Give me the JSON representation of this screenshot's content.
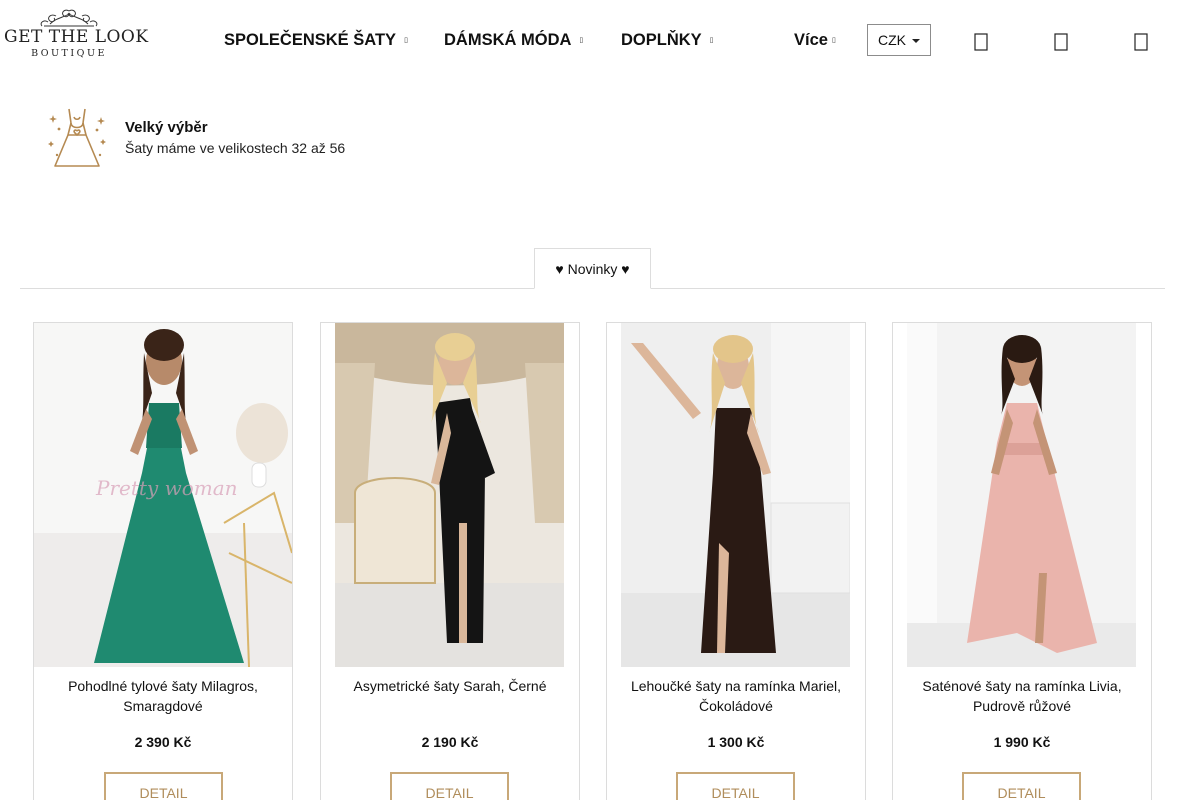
{
  "header": {
    "logo_main": "GET THE LOOK",
    "logo_sub": "BOUTIQUE",
    "nav": [
      {
        "label": "SPOLEČENSKÉ ŠATY",
        "caret": "▯"
      },
      {
        "label": "DÁMSKÁ MÓDA",
        "caret": "▯"
      },
      {
        "label": "DOPLŇKY",
        "caret": "▯"
      },
      {
        "label": "Více",
        "caret": "▯"
      }
    ],
    "currency": "CZK",
    "icons": [
      "search-icon",
      "user-icon",
      "cart-icon"
    ]
  },
  "benefit": {
    "icon": "dress-icon",
    "title": "Velký výběr",
    "text": "Šaty máme ve velikostech 32 až 56"
  },
  "tabs": {
    "active_label": "♥ Novinky ♥"
  },
  "products": [
    {
      "name": "Pohodlné tylové šaty Milagros, Smaragdové",
      "price": "2 390 Kč",
      "button": "DETAIL",
      "dress_color": "#1f8a70",
      "watermark": "Pretty woman"
    },
    {
      "name": "Asymetrické šaty Sarah, Černé",
      "price": "2 190 Kč",
      "button": "DETAIL",
      "dress_color": "#141414"
    },
    {
      "name": "Lehoučké šaty na ramínka Mariel, Čokoládové",
      "price": "1 300 Kč",
      "button": "DETAIL",
      "dress_color": "#2a1a14"
    },
    {
      "name": "Saténové šaty na ramínka Livia, Pudrově růžové",
      "price": "1 990 Kč",
      "button": "DETAIL",
      "dress_color": "#eab4ac"
    }
  ],
  "colors": {
    "accent_gold": "#c8a878",
    "accent_text": "#b08d5b",
    "border": "#dcdcdc"
  }
}
